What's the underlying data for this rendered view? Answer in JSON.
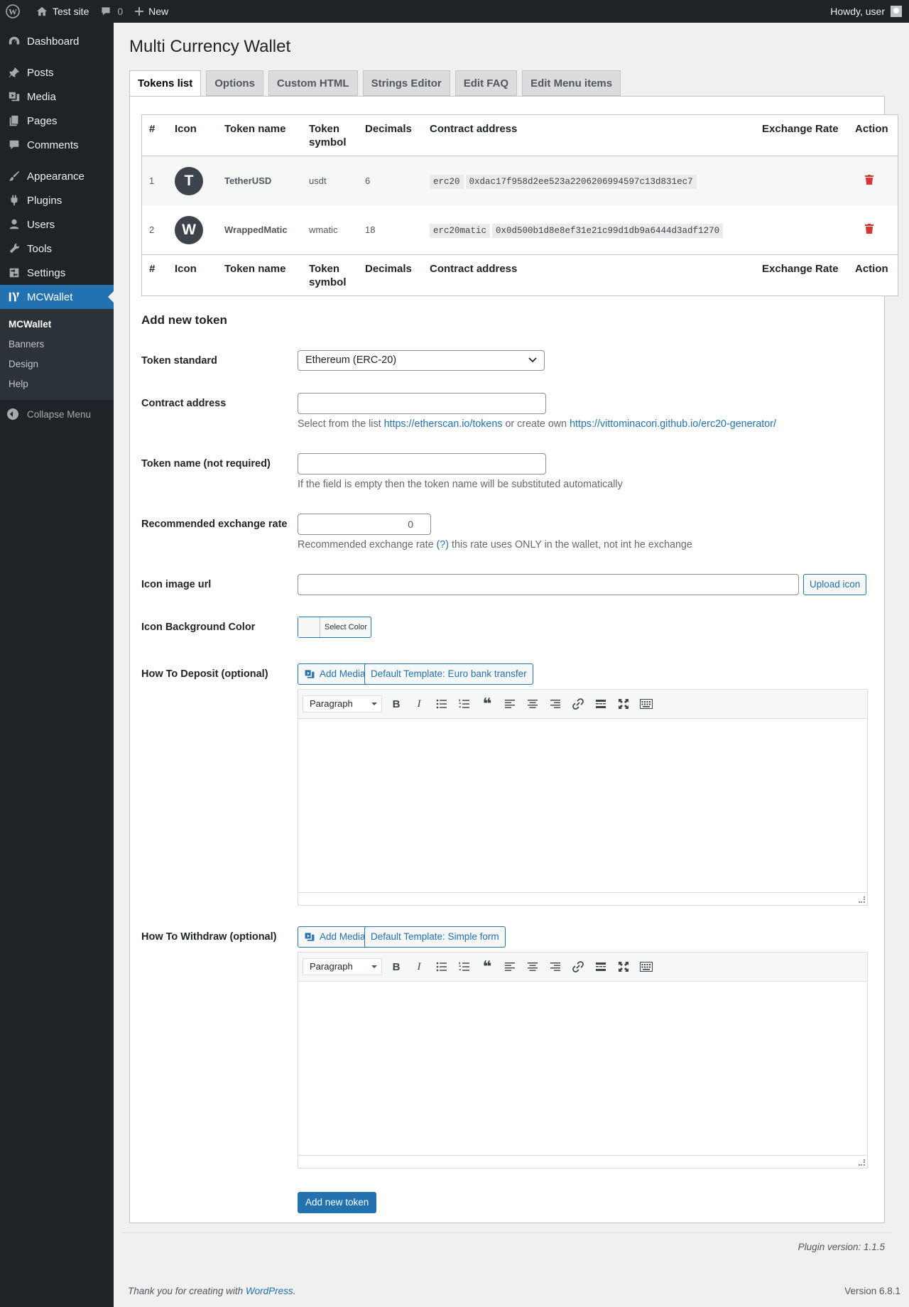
{
  "adminbar": {
    "site_name": "Test site",
    "comments_count": "0",
    "new_label": "New",
    "howdy": "Howdy, user"
  },
  "sidebar": {
    "items": [
      {
        "label": "Dashboard",
        "icon": "dashboard-icon"
      },
      {
        "label": "Posts",
        "icon": "pin-icon"
      },
      {
        "label": "Media",
        "icon": "media-icon"
      },
      {
        "label": "Pages",
        "icon": "pages-icon"
      },
      {
        "label": "Comments",
        "icon": "comment-icon"
      },
      {
        "label": "Appearance",
        "icon": "brush-icon"
      },
      {
        "label": "Plugins",
        "icon": "plugin-icon"
      },
      {
        "label": "Users",
        "icon": "user-icon"
      },
      {
        "label": "Tools",
        "icon": "wrench-icon"
      },
      {
        "label": "Settings",
        "icon": "settings-icon"
      },
      {
        "label": "MCWallet",
        "icon": "mcwallet-icon"
      }
    ],
    "submenu": [
      "MCWallet",
      "Banners",
      "Design",
      "Help"
    ],
    "collapse": "Collapse Menu"
  },
  "page": {
    "title": "Multi Currency Wallet",
    "tabs": [
      "Tokens list",
      "Options",
      "Custom HTML",
      "Strings Editor",
      "Edit FAQ",
      "Edit Menu items"
    ]
  },
  "table": {
    "headers": [
      "#",
      "Icon",
      "Token name",
      "Token symbol",
      "Decimals",
      "Contract address",
      "Exchange Rate",
      "Action"
    ],
    "header_token_symbol": [
      "Token",
      "symbol"
    ],
    "rows": [
      {
        "num": "1",
        "icon_letter": "T",
        "name": "TetherUSD",
        "symbol": "usdt",
        "decimals": "6",
        "standard": "erc20",
        "address": "0xdac17f958d2ee523a2206206994597c13d831ec7",
        "rate": ""
      },
      {
        "num": "2",
        "icon_letter": "W",
        "name": "WrappedMatic",
        "symbol": "wmatic",
        "decimals": "18",
        "standard": "erc20matic",
        "address": "0x0d500b1d8e8ef31e21c99d1db9a6444d3adf1270",
        "rate": ""
      }
    ]
  },
  "form": {
    "heading": "Add new token",
    "token_standard_label": "Token standard",
    "token_standard_value": "Ethereum (ERC-20)",
    "contract_label": "Contract address",
    "contract_desc_prefix": "Select from the list",
    "contract_link1": "https://etherscan.io/tokens",
    "contract_desc_mid": "or create own",
    "contract_link2": "https://vittominacori.github.io/erc20-generator/",
    "name_label": "Token name (not required)",
    "name_desc": "If the field is empty then the token name will be substituted automatically",
    "rate_label": "Recommended exchange rate",
    "rate_value": "0",
    "rate_desc_prefix": "Recommended exchange rate",
    "rate_help_link": "(?)",
    "rate_desc_suffix": "this rate uses ONLY in the wallet, not int he exchange",
    "icon_url_label": "Icon image url",
    "upload_icon": "Upload icon",
    "bg_color_label": "Icon Background Color",
    "select_color": "Select Color",
    "deposit_label": "How To Deposit (optional)",
    "withdraw_label": "How To Withdraw (optional)",
    "add_media": "Add Media",
    "deposit_template": "Default Template: Euro bank transfer",
    "withdraw_template": "Default Template: Simple form",
    "paragraph": "Paragraph",
    "submit": "Add new token"
  },
  "plugin_version": "Plugin version: 1.1.5",
  "footer": {
    "thanks_prefix": "Thank you for creating with",
    "wp_link": "WordPress",
    "thanks_suffix": ".",
    "version": "Version 6.8.1"
  },
  "colors": {
    "admin_dark": "#1d2327",
    "accent": "#2271b1",
    "delete": "#d63638"
  }
}
